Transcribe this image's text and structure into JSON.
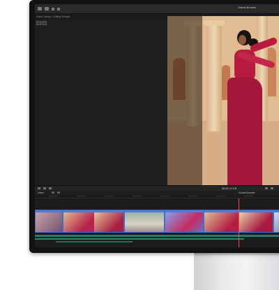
{
  "toolbar": {
    "right_label": "Global Browse",
    "icons": [
      "import-icon",
      "keyword-icon",
      "checkmark-icon",
      "share-icon"
    ]
  },
  "browser": {
    "breadcrumb": "Video Library › Editing Sample"
  },
  "timeline": {
    "project_label": "Index",
    "timecode": "00:01:17:18",
    "right_label": "Global Browse"
  }
}
